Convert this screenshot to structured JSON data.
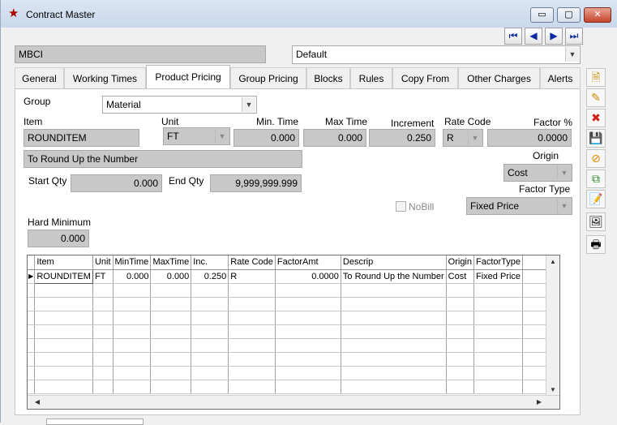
{
  "window": {
    "title": "Contract Master",
    "icon": "star-icon",
    "controls": {
      "minimize": "▭",
      "maximize": "▢",
      "close": "✕"
    }
  },
  "record_nav": {
    "first": "⏮",
    "prev": "◀",
    "next": "▶",
    "last": "⏭"
  },
  "header": {
    "contract_code": "MBCI",
    "profile_select": "Default"
  },
  "tabs": [
    {
      "label": "General"
    },
    {
      "label": "Working Times"
    },
    {
      "label": "Product Pricing"
    },
    {
      "label": "Group Pricing"
    },
    {
      "label": "Blocks"
    },
    {
      "label": "Rules"
    },
    {
      "label": "Copy From"
    },
    {
      "label": "Other Charges"
    },
    {
      "label": "Alerts"
    }
  ],
  "form": {
    "group_label": "Group",
    "group_value": "Material",
    "item_label": "Item",
    "item_value": "ROUNDITEM",
    "unit_label": "Unit",
    "unit_value": "FT",
    "min_time_label": "Min. Time",
    "min_time_value": "0.000",
    "max_time_label": "Max Time",
    "max_time_value": "0.000",
    "increment_label": "Increment",
    "increment_value": "0.250",
    "rate_code_label": "Rate Code",
    "rate_code_value": "R",
    "factor_label": "Factor %",
    "factor_value": "0.0000",
    "description_value": "To Round Up the Number",
    "origin_label": "Origin",
    "origin_value": "Cost",
    "start_qty_label": "Start Qty",
    "start_qty_value": "0.000",
    "end_qty_label": "End Qty",
    "end_qty_value": "9,999,999.999",
    "factor_type_label": "Factor Type",
    "factor_type_value": "Fixed Price",
    "nobill_label": "NoBill",
    "hard_min_label": "Hard Minimum",
    "hard_min_value": "0.000"
  },
  "grid": {
    "columns": [
      "Item",
      "Unit",
      "MinTime",
      "MaxTime",
      "Inc.",
      "Rate Code",
      "FactorAmt",
      "Descrip",
      "Origin",
      "FactorType"
    ],
    "rows": [
      [
        "ROUNDITEM",
        "FT",
        "0.000",
        "0.000",
        "0.250",
        "R",
        "0.0000",
        "To Round Up the Number",
        "Cost",
        "Fixed Price"
      ]
    ],
    "row_indicator": "▶",
    "scroll_up": "▲",
    "scroll_down": "▼",
    "scroll_left": "◀",
    "scroll_right": "▶"
  },
  "sidebar": [
    {
      "name": "new-record-icon",
      "glyph": "🗎"
    },
    {
      "name": "edit-record-icon",
      "glyph": "✎"
    },
    {
      "name": "delete-record-icon",
      "glyph": "✖"
    },
    {
      "name": "save-icon",
      "glyph": "💾"
    },
    {
      "name": "cancel-icon",
      "glyph": "⊘"
    },
    {
      "name": "copy-icon",
      "glyph": "⧉"
    },
    {
      "name": "notes-icon",
      "glyph": "📝"
    },
    {
      "name": "report-icon",
      "glyph": "🖼"
    },
    {
      "name": "print-icon",
      "glyph": "🖶"
    }
  ],
  "colors": {
    "close_red": "#c8432b",
    "nav_blue": "#0a2aa3",
    "disabled_grey": "#c8c8c8"
  }
}
